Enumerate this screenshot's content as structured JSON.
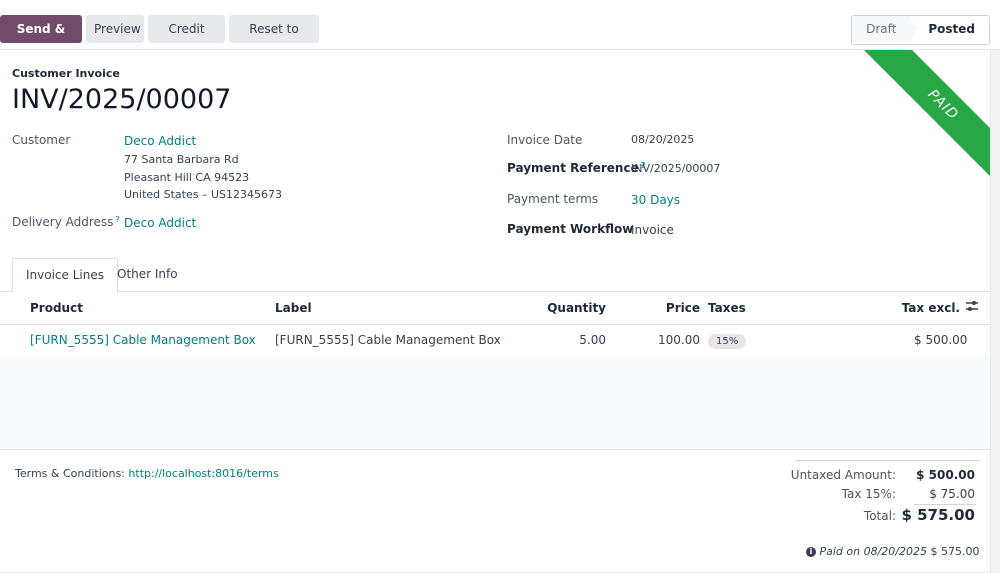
{
  "toolbar": {
    "send_print": "Send & Print",
    "preview": "Preview",
    "credit_note": "Credit Note",
    "reset_draft": "Reset to Draft",
    "status_draft": "Draft",
    "status_posted": "Posted"
  },
  "ribbon": "PAID",
  "invoice": {
    "type": "Customer Invoice",
    "number": "INV/2025/00007",
    "customer_label": "Customer",
    "customer_name": "Deco Addict",
    "address_line1": "77 Santa Barbara Rd",
    "address_line2": "Pleasant Hill CA 94523",
    "address_line3": "United States – US12345673",
    "delivery_label": "Delivery Address",
    "delivery_value": "Deco Addict",
    "date_label": "Invoice Date",
    "date_value": "08/20/2025",
    "payref_label": "Payment Reference",
    "payref_value": "INV/2025/00007",
    "terms_label": "Payment terms",
    "terms_value": "30 Days",
    "workflow_label": "Payment Workflow",
    "workflow_value": "Invoice",
    "help_mark": "?"
  },
  "tabs": [
    "Invoice Lines",
    "Other Info"
  ],
  "table": {
    "headers": {
      "product": "Product",
      "label": "Label",
      "quantity": "Quantity",
      "price": "Price",
      "taxes": "Taxes",
      "tax_excl": "Tax excl."
    },
    "rows": [
      {
        "product": "[FURN_5555] Cable Management Box",
        "label": "[FURN_5555] Cable Management Box",
        "quantity": "5.00",
        "price": "100.00",
        "tax": "15%",
        "tax_excl": "$ 500.00"
      }
    ]
  },
  "footer": {
    "terms_label": "Terms & Conditions:",
    "terms_link": "http://localhost:8016/terms",
    "untaxed_label": "Untaxed Amount:",
    "untaxed_value": "$ 500.00",
    "tax_label": "Tax 15%:",
    "tax_value": "$ 75.00",
    "total_label": "Total:",
    "total_value": "$ 575.00",
    "paid_label": "Paid on 08/20/2025",
    "paid_value": "$ 575.00"
  },
  "colors": {
    "primary": "#714b67",
    "link": "#017e84",
    "ribbon": "#28a745"
  }
}
